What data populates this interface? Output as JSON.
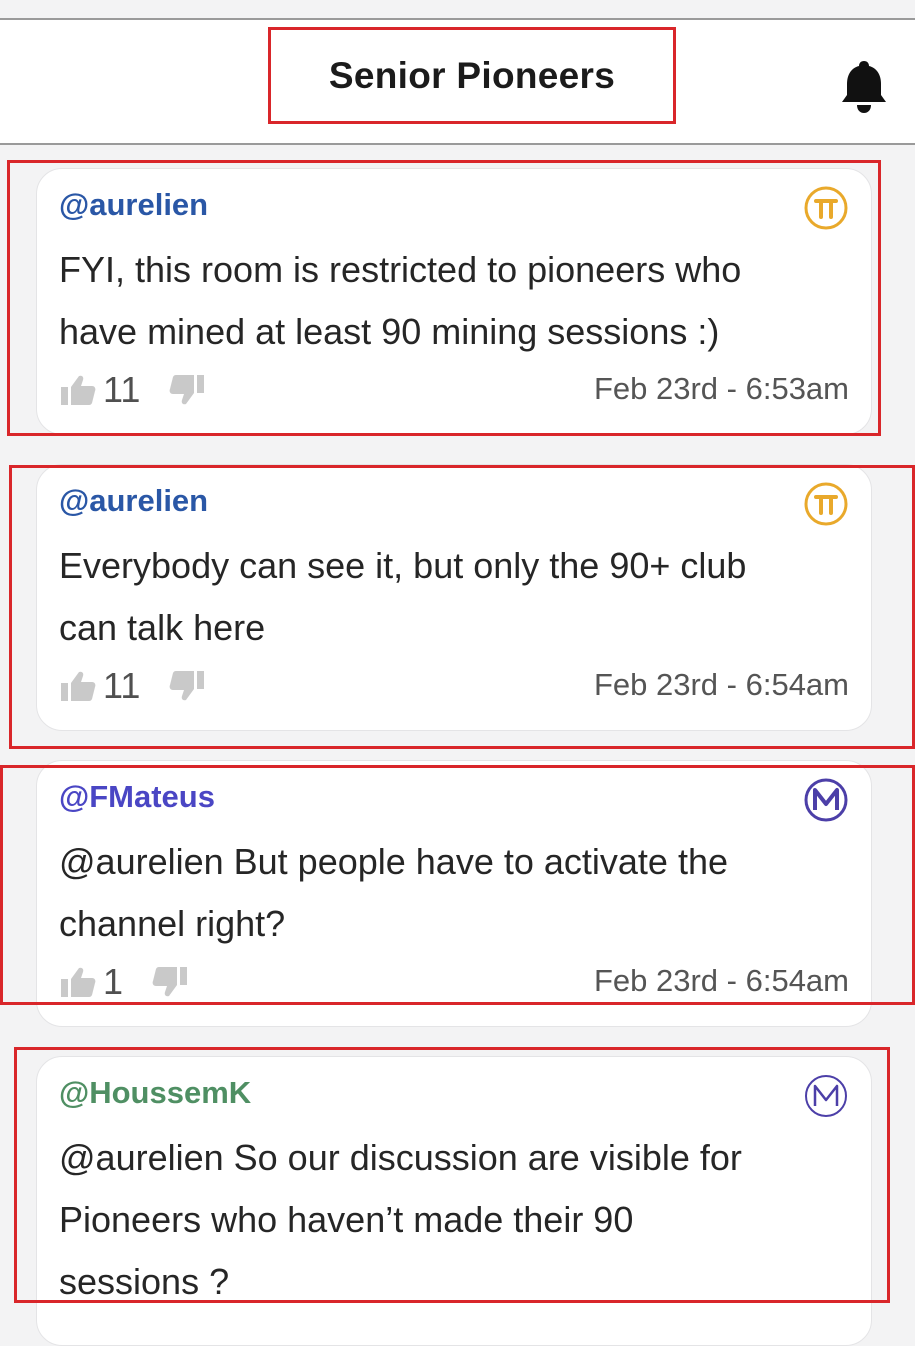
{
  "header": {
    "title": "Senior Pioneers"
  },
  "icons": {
    "bell": "bell-icon",
    "like": "thumbs-up-icon",
    "dislike": "thumbs-down-icon",
    "pi": "pi-coin-badge-icon",
    "moderator": "moderator-m-badge-icon"
  },
  "colors": {
    "highlight": "#d9262a",
    "pi_gold": "#e9a92b",
    "moderator_purple": "#4c3fa8",
    "user_blue": "#2a57a6",
    "user_purple": "#4a46c4",
    "user_green": "#4f8f63"
  },
  "messages": [
    {
      "user": "@aurelien",
      "badge": "pi",
      "text": "FYI, this room is restricted to pioneers who\nhave mined at least 90 mining sessions :)",
      "likes": "11",
      "time": "Feb 23rd - 6:53am"
    },
    {
      "user": "@aurelien",
      "badge": "pi",
      "text": "Everybody can see it, but only the 90+ club\ncan talk here",
      "likes": "11",
      "time": "Feb 23rd - 6:54am"
    },
    {
      "user": "@FMateus",
      "badge": "moderator",
      "text": "@aurelien But people have to activate the\nchannel right?",
      "likes": "1",
      "time": "Feb 23rd - 6:54am"
    },
    {
      "user": "@HoussemK",
      "badge": "moderator",
      "text": "@aurelien So our discussion are visible for\nPioneers who haven’t made their 90\nsessions ?"
    }
  ]
}
